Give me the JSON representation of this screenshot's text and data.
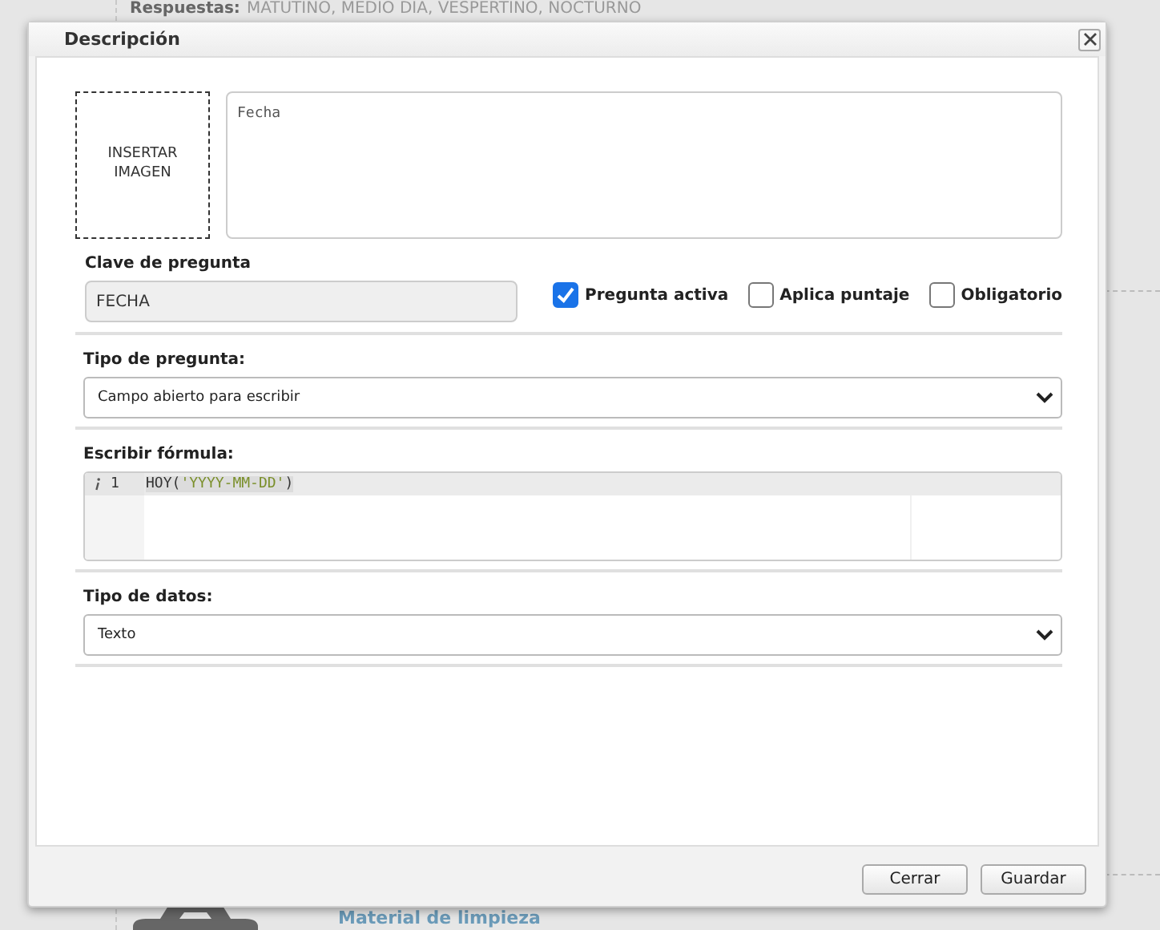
{
  "background_page": {
    "answers_label": "Respuestas:",
    "answers_value": "MATUTINO, MEDIO DIA, VESPERTINO, NOCTURNO",
    "item_title": "Material de limpieza"
  },
  "dialog": {
    "title": "Descripción",
    "image_placeholder": "INSERTAR IMAGEN",
    "description": {
      "value": "Fecha"
    },
    "key": {
      "label": "Clave de pregunta",
      "value": "FECHA",
      "disabled": true
    },
    "options": [
      {
        "label": "Pregunta activa",
        "checked": true
      },
      {
        "label": "Aplica puntaje",
        "checked": false
      },
      {
        "label": "Obligatorio",
        "checked": false
      }
    ],
    "question_type": {
      "label": "Tipo de pregunta:",
      "value": "Campo abierto para escribir"
    },
    "formula": {
      "label": "Escribir fórmula:",
      "lines": [
        {
          "number": "1",
          "code": "HOY('YYYY-MM-DD')"
        }
      ]
    },
    "data_type": {
      "label": "Tipo de datos:",
      "value": "Texto"
    },
    "buttons": [
      "Cerrar",
      "Guardar"
    ]
  }
}
